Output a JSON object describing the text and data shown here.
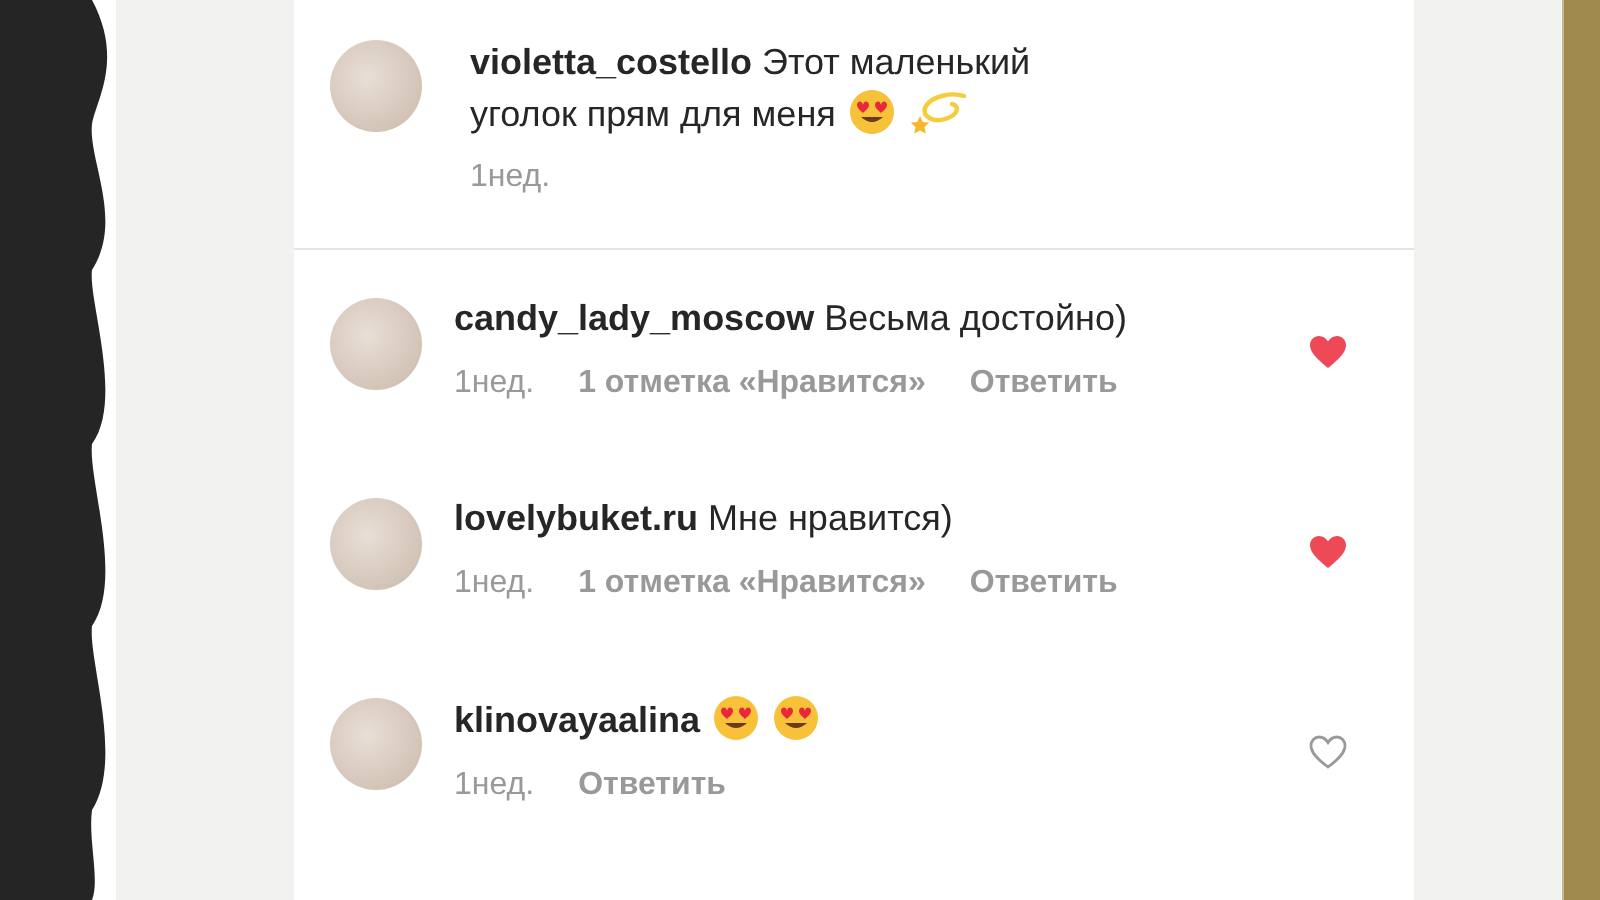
{
  "caption": {
    "lines": [
      "**violetta_costello** Этот маленький",
      "уголок прям для меня"
    ],
    "emojis": [
      {
        "kind": "heart-eyes"
      },
      {
        "kind": "dizzy"
      }
    ],
    "time": "1нед."
  },
  "comments": [
    {
      "text": "**candy_lady_moscow** Весьма достойно)",
      "time": "1нед.",
      "likes": "1 отметка «Нравится»",
      "reply": "Ответить",
      "liked": true
    },
    {
      "text": "**lovelybuket.ru** Мне нравится)",
      "time": "1нед.",
      "likes": "1 отметка «Нравится»",
      "reply": "Ответить",
      "liked": true
    },
    {
      "text": "**klinovayaalina**",
      "emojis": [
        {
          "kind": "heart-eyes"
        },
        {
          "kind": "heart-eyes"
        }
      ],
      "time": "1нед.",
      "reply": "Ответить",
      "liked": false
    }
  ]
}
